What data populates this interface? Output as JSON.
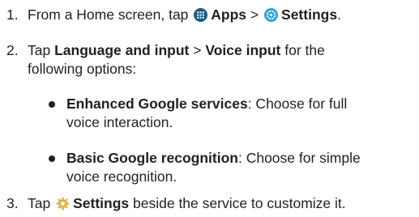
{
  "steps": [
    {
      "num": "1.",
      "pre": "From a Home screen, tap",
      "apps": "Apps",
      "sep": ">",
      "settings": "Settings",
      "end": "."
    },
    {
      "num": "2.",
      "pre": "Tap",
      "lang": "Language and input",
      "sep": ">",
      "voice": "Voice input",
      "post1": "for the",
      "post2": "following options:",
      "bullets": [
        {
          "term": "Enhanced Google services",
          "desc1": ": Choose for full",
          "desc2": "voice interaction."
        },
        {
          "term": "Basic Google recognition",
          "desc1": ": Choose for simple",
          "desc2": "voice recognition."
        }
      ]
    },
    {
      "num": "3.",
      "pre": "Tap",
      "settings": "Settings",
      "post": "beside the service to customize it."
    }
  ],
  "icons": {
    "apps": "apps-grid-icon",
    "settings_app": "settings-app-icon",
    "settings_gear": "gear-icon"
  },
  "colors": {
    "text": "#231f20",
    "apps_icon_bg": "#1e5b87",
    "settings_icon_ring": "#2fa3d6",
    "gear": "#d9b54a"
  }
}
